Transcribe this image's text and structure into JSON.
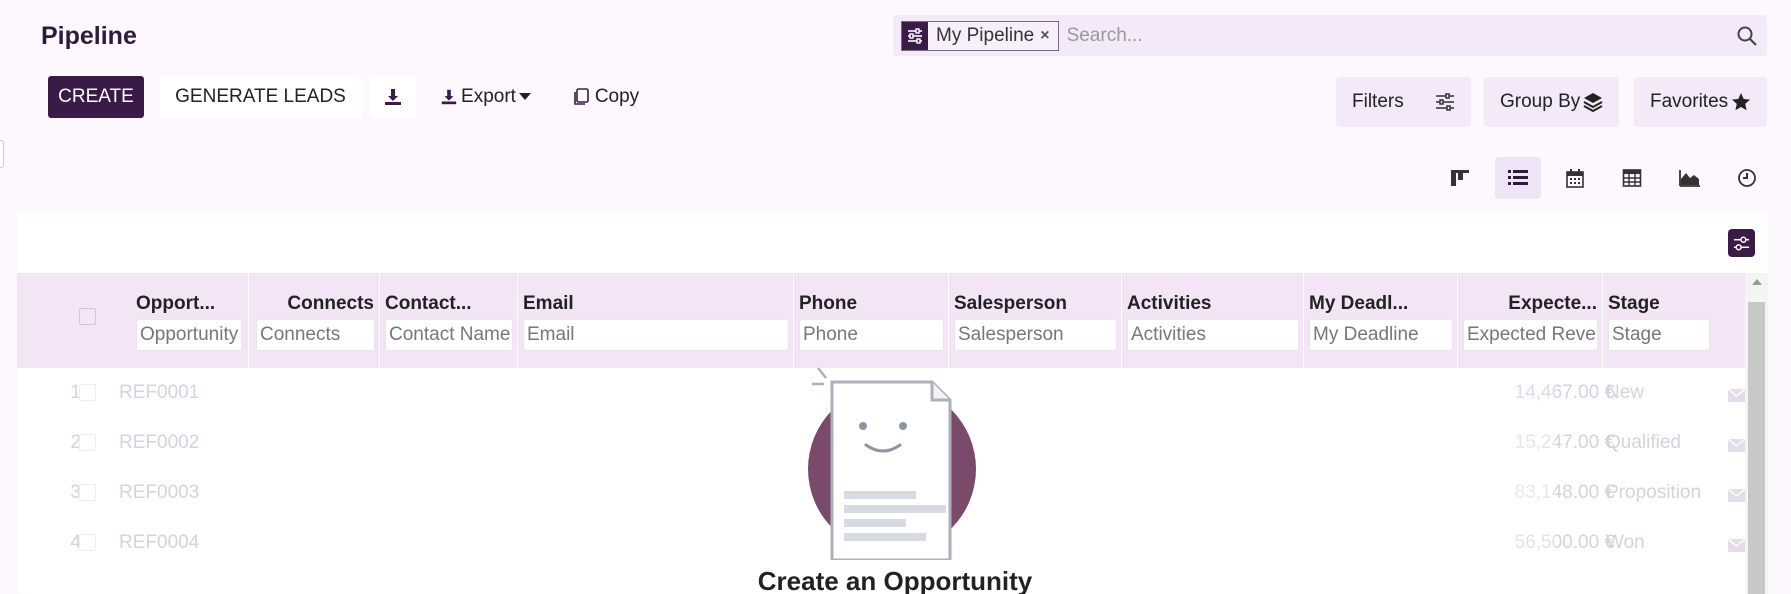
{
  "page_title": "Pipeline",
  "search": {
    "facet_label": "My Pipeline",
    "facet_remove": "×",
    "placeholder": "Search..."
  },
  "toolbar": {
    "create_label": "CREATE",
    "generate_leads_label": "GENERATE LEADS",
    "export_label": "Export",
    "copy_label": "Copy"
  },
  "filter_buttons": {
    "filters_label": "Filters",
    "group_by_label": "Group By",
    "favorites_label": "Favorites"
  },
  "views": [
    "kanban",
    "list",
    "calendar",
    "pivot",
    "graph",
    "activity"
  ],
  "active_view": "list",
  "table": {
    "columns": [
      {
        "label": "Opport...",
        "placeholder": "Opportunity"
      },
      {
        "label": "Connects",
        "placeholder": "Connects"
      },
      {
        "label": "Contact...",
        "placeholder": "Contact Name"
      },
      {
        "label": "Email",
        "placeholder": "Email"
      },
      {
        "label": "Phone",
        "placeholder": "Phone"
      },
      {
        "label": "Salesperson",
        "placeholder": "Salesperson"
      },
      {
        "label": "Activities",
        "placeholder": "Activities"
      },
      {
        "label": "My Deadl...",
        "placeholder": "My Deadline"
      },
      {
        "label": "Expecte...",
        "placeholder": "Expected Reve"
      },
      {
        "label": "Stage",
        "placeholder": "Stage"
      }
    ],
    "rows": [
      {
        "num": "1",
        "ref": "REF0001",
        "revenue": "14,467.00 €",
        "stage": "New"
      },
      {
        "num": "2",
        "ref": "REF0002",
        "revenue": "15,247.00 €",
        "stage": "Qualified"
      },
      {
        "num": "3",
        "ref": "REF0003",
        "revenue": "83,148.00 €",
        "stage": "Proposition"
      },
      {
        "num": "4",
        "ref": "REF0004",
        "revenue": "56,500.00 €",
        "stage": "Won"
      }
    ]
  },
  "empty_state": {
    "title": "Create an Opportunity"
  },
  "colors": {
    "brand": "#3a1b47",
    "helper_circle": "#7a4a6b",
    "header_bg": "#f3e5f6"
  }
}
